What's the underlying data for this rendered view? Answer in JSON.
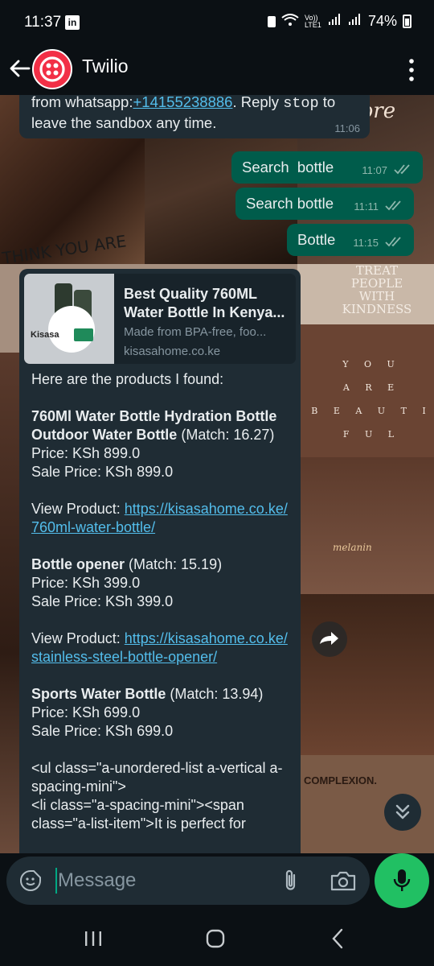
{
  "status_bar": {
    "time": "11:37",
    "network_label": "Vo)) LTE1",
    "battery": "74%"
  },
  "header": {
    "contact_name": "Twilio"
  },
  "messages": {
    "incoming_top": {
      "prefix": "from whatsapp:",
      "phone": "+14155238886",
      "mid": ". Reply ",
      "stop": "stop",
      "after": " to",
      "line2": "leave the sandbox any time.",
      "time": "11:06"
    },
    "outgoing": [
      {
        "text": "Search  bottle",
        "time": "11:07"
      },
      {
        "text": "Search bottle",
        "time": "11:11"
      },
      {
        "text": "Bottle",
        "time": "11:15"
      }
    ],
    "product_card": {
      "preview": {
        "title_line1": "Best Quality 760ML",
        "title_line2": "Water Bottle In Kenya...",
        "description": "Made from BPA-free, foo...",
        "domain": "kisasahome.co.ke",
        "image_logo": "Kisasa"
      },
      "intro": "Here are the products I found:",
      "products": [
        {
          "name": "760Ml Water Bottle Hydration Bottle Outdoor Water Bottle",
          "match": " (Match: 16.27)",
          "price": "Price: KSh 899.0",
          "sale_price": "Sale Price: KSh 899.0",
          "view_label": "View Product: ",
          "url": "https://kisasahome.co.ke/760ml-water-bottle/"
        },
        {
          "name": "Bottle opener",
          "match": " (Match: 15.19)",
          "price": "Price: KSh 399.0",
          "sale_price": "Sale Price: KSh 399.0",
          "view_label": "View Product: ",
          "url": "https://kisasahome.co.ke/stainless-steel-bottle-opener/"
        },
        {
          "name": "Sports Water Bottle",
          "match": " (Match: 13.94)",
          "price": "Price: KSh 699.0",
          "sale_price": "Sale Price: KSh 699.0"
        }
      ],
      "html_snippet": "<ul class=\"a-unordered-list a-vertical a-spacing-mini\">\n<li class=\"a-spacing-mini\"><span class=\"a-list-item\">It is perfect for"
    }
  },
  "wallpaper_text": {
    "treat": "TREAT PEOPLE WITH KINDNESS",
    "you": "Y O U",
    "are": "A R E",
    "beautiful": "B E A U T I F U L",
    "adore": "dore",
    "think": "THINK YOU ARE",
    "melanin": "melanin",
    "complexion": "COMPLEXION."
  },
  "composer": {
    "placeholder": "Message"
  },
  "colors": {
    "accent": "#00a884",
    "mic": "#21c063",
    "outgoing_bubble": "#005c4b",
    "incoming_bubble": "#1f2c34",
    "link": "#53bdeb"
  }
}
